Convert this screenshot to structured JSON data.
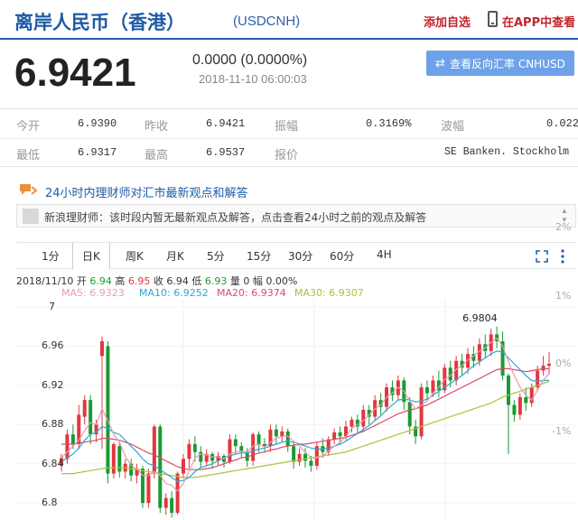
{
  "header": {
    "title": "离岸人民币（香港）",
    "symbol": "(USDCNH)",
    "add_watchlist": "添加自选",
    "app_view": "在APP中查看"
  },
  "quote": {
    "price": "6.9421",
    "change": "0.0000 (0.0000%)",
    "time": "2018-11-10 06:00:03",
    "reverse_button": "查看反向汇率 CNHUSD"
  },
  "stats": {
    "open_label": "今开",
    "open_value": "6.9390",
    "prev_close_label": "昨收",
    "prev_close_value": "6.9421",
    "amplitude_label": "振幅",
    "amplitude_value": "0.3169%",
    "range_label": "波幅",
    "range_value": "0.022",
    "low_label": "最低",
    "low_value": "6.9317",
    "high_label": "最高",
    "high_value": "6.9537",
    "quote_label": "报价",
    "quote_value": "SE Banken. Stockholm"
  },
  "advice": {
    "title": "24小时内理财师对汇市最新观点和解答",
    "message": "新浪理财师：该时段内暂无最新观点及解答，点击查看24小时之前的观点及解答"
  },
  "tabs": [
    "1分",
    "日K",
    "周K",
    "月K",
    "5分",
    "15分",
    "30分",
    "60分",
    "4H"
  ],
  "active_tab": "日K",
  "ohlc": {
    "date": "2018/11/10",
    "open_label": "开",
    "open": "6.94",
    "high_label": "高",
    "high": "6.95",
    "close_label": "收",
    "close": "6.94",
    "low_label": "低",
    "low": "6.93",
    "volume_label": "量",
    "volume": "0",
    "amp_label": "幅",
    "amp": "0.00%"
  },
  "ma": {
    "ma5": "MA5: 6.9323",
    "ma10": "MA10: 6.9252",
    "ma20": "MA20: 6.9374",
    "ma30": "MA30: 6.9307"
  },
  "colors": {
    "up": "#e0383e",
    "down": "#1a9a33",
    "ma5": "#e89bb0",
    "ma10": "#2aa7d6",
    "ma20": "#d94c6a",
    "ma30": "#a6c43a",
    "accent": "#1f5aa6"
  },
  "chart_data": {
    "type": "candlestick",
    "y_ticks_left": [
      "7",
      "6.96",
      "6.92",
      "6.88",
      "6.84",
      "6.8"
    ],
    "y_ticks_right": [
      "2%",
      "1%",
      "0%",
      "-1%"
    ],
    "max_label": "6.9804",
    "ylim": [
      6.79,
      7.0
    ],
    "candles": [
      [
        6.838,
        6.846,
        6.832,
        6.85
      ],
      [
        6.845,
        6.87,
        6.84,
        6.875
      ],
      [
        6.87,
        6.86,
        6.855,
        6.88
      ],
      [
        6.86,
        6.89,
        6.855,
        6.9
      ],
      [
        6.888,
        6.905,
        6.88,
        6.91
      ],
      [
        6.905,
        6.87,
        6.86,
        6.91
      ],
      [
        6.87,
        6.88,
        6.862,
        6.885
      ],
      [
        6.95,
        6.965,
        6.855,
        6.97
      ],
      [
        6.96,
        6.83,
        6.82,
        6.965
      ],
      [
        6.83,
        6.86,
        6.825,
        6.862
      ],
      [
        6.858,
        6.832,
        6.826,
        6.862
      ],
      [
        6.832,
        6.84,
        6.825,
        6.845
      ],
      [
        6.84,
        6.828,
        6.822,
        6.845
      ],
      [
        6.828,
        6.835,
        6.82,
        6.84
      ],
      [
        6.835,
        6.8,
        6.795,
        6.838
      ],
      [
        6.8,
        6.83,
        6.795,
        6.835
      ],
      [
        6.83,
        6.878,
        6.825,
        6.88
      ],
      [
        6.878,
        6.795,
        6.79,
        6.88
      ],
      [
        6.795,
        6.805,
        6.788,
        6.81
      ],
      [
        6.805,
        6.79,
        6.785,
        6.812
      ],
      [
        6.79,
        6.83,
        6.788,
        6.832
      ],
      [
        6.83,
        6.845,
        6.825,
        6.85
      ],
      [
        6.845,
        6.86,
        6.835,
        6.865
      ],
      [
        6.86,
        6.852,
        6.842,
        6.868
      ],
      [
        6.852,
        6.842,
        6.836,
        6.858
      ],
      [
        6.842,
        6.85,
        6.838,
        6.855
      ],
      [
        6.85,
        6.843,
        6.835,
        6.852
      ],
      [
        6.843,
        6.848,
        6.838,
        6.852
      ],
      [
        6.848,
        6.842,
        6.836,
        6.85
      ],
      [
        6.842,
        6.865,
        6.84,
        6.87
      ],
      [
        6.865,
        6.858,
        6.85,
        6.87
      ],
      [
        6.858,
        6.852,
        6.846,
        6.862
      ],
      [
        6.852,
        6.843,
        6.837,
        6.856
      ],
      [
        6.843,
        6.87,
        6.838,
        6.872
      ],
      [
        6.87,
        6.86,
        6.852,
        6.873
      ],
      [
        6.86,
        6.858,
        6.852,
        6.866
      ],
      [
        6.858,
        6.875,
        6.852,
        6.88
      ],
      [
        6.875,
        6.868,
        6.86,
        6.88
      ],
      [
        6.868,
        6.873,
        6.862,
        6.878
      ],
      [
        6.873,
        6.858,
        6.852,
        6.876
      ],
      [
        6.858,
        6.842,
        6.835,
        6.862
      ],
      [
        6.842,
        6.85,
        6.838,
        6.856
      ],
      [
        6.85,
        6.843,
        6.836,
        6.856
      ],
      [
        6.843,
        6.838,
        6.832,
        6.848
      ],
      [
        6.838,
        6.858,
        6.834,
        6.862
      ],
      [
        6.858,
        6.852,
        6.846,
        6.866
      ],
      [
        6.852,
        6.865,
        6.848,
        6.868
      ],
      [
        6.865,
        6.872,
        6.86,
        6.876
      ],
      [
        6.872,
        6.868,
        6.86,
        6.878
      ],
      [
        6.868,
        6.878,
        6.864,
        6.884
      ],
      [
        6.878,
        6.885,
        6.872,
        6.888
      ],
      [
        6.885,
        6.878,
        6.87,
        6.89
      ],
      [
        6.878,
        6.895,
        6.873,
        6.9
      ],
      [
        6.895,
        6.888,
        6.88,
        6.9
      ],
      [
        6.888,
        6.905,
        6.884,
        6.91
      ],
      [
        6.905,
        6.898,
        6.89,
        6.912
      ],
      [
        6.898,
        6.918,
        6.893,
        6.922
      ],
      [
        6.918,
        6.91,
        6.904,
        6.925
      ],
      [
        6.91,
        6.925,
        6.905,
        6.93
      ],
      [
        6.925,
        6.903,
        6.895,
        6.928
      ],
      [
        6.903,
        6.878,
        6.87,
        6.908
      ],
      [
        6.878,
        6.868,
        6.86,
        6.885
      ],
      [
        6.868,
        6.918,
        6.865,
        6.922
      ],
      [
        6.918,
        6.912,
        6.905,
        6.925
      ],
      [
        6.912,
        6.925,
        6.908,
        6.93
      ],
      [
        6.925,
        6.915,
        6.908,
        6.935
      ],
      [
        6.915,
        6.938,
        6.912,
        6.942
      ],
      [
        6.938,
        6.925,
        6.918,
        6.945
      ],
      [
        6.925,
        6.945,
        6.92,
        6.95
      ],
      [
        6.945,
        6.938,
        6.93,
        6.952
      ],
      [
        6.938,
        6.952,
        6.932,
        6.958
      ],
      [
        6.952,
        6.945,
        6.938,
        6.96
      ],
      [
        6.945,
        6.962,
        6.94,
        6.968
      ],
      [
        6.962,
        6.955,
        6.948,
        6.972
      ],
      [
        6.955,
        6.972,
        6.95,
        6.978
      ],
      [
        6.972,
        6.965,
        6.958,
        6.98
      ],
      [
        6.965,
        6.93,
        6.925,
        6.975
      ],
      [
        6.93,
        6.9,
        6.85,
        6.932
      ],
      [
        6.9,
        6.89,
        6.883,
        6.905
      ],
      [
        6.89,
        6.908,
        6.885,
        6.912
      ],
      [
        6.908,
        6.902,
        6.894,
        6.918
      ],
      [
        6.902,
        6.918,
        6.898,
        6.922
      ],
      [
        6.918,
        6.935,
        6.914,
        6.94
      ],
      [
        6.935,
        6.94,
        6.93,
        6.95
      ],
      [
        6.94,
        6.942,
        6.931,
        6.954
      ]
    ],
    "ma5": [
      6.846,
      6.852,
      6.858,
      6.864,
      6.874,
      6.882,
      6.88,
      6.896,
      6.884,
      6.87,
      6.862,
      6.848,
      6.838,
      6.835,
      6.828,
      6.828,
      6.832,
      6.828,
      6.82,
      6.818,
      6.812,
      6.82,
      6.832,
      6.846,
      6.85,
      6.849,
      6.847,
      6.847,
      6.845,
      6.85,
      6.852,
      6.853,
      6.852,
      6.858,
      6.86,
      6.857,
      6.862,
      6.866,
      6.868,
      6.868,
      6.863,
      6.858,
      6.852,
      6.846,
      6.846,
      6.848,
      6.853,
      6.858,
      6.862,
      6.868,
      6.876,
      6.88,
      6.884,
      6.89,
      6.896,
      6.9,
      6.908,
      6.912,
      6.918,
      6.914,
      6.904,
      6.896,
      6.9,
      6.904,
      6.912,
      6.918,
      6.926,
      6.93,
      6.936,
      6.94,
      6.946,
      6.95,
      6.955,
      6.958,
      6.964,
      6.968,
      6.96,
      6.944,
      6.93,
      6.918,
      6.91,
      6.905,
      6.915,
      6.925,
      6.932
    ],
    "ma10": [
      6.842,
      6.846,
      6.85,
      6.856,
      6.864,
      6.87,
      6.872,
      6.878,
      6.876,
      6.872,
      6.87,
      6.864,
      6.858,
      6.852,
      6.845,
      6.84,
      6.838,
      6.834,
      6.83,
      6.826,
      6.822,
      6.823,
      6.826,
      6.832,
      6.836,
      6.838,
      6.84,
      6.843,
      6.846,
      6.848,
      6.85,
      6.851,
      6.851,
      6.853,
      6.855,
      6.856,
      6.858,
      6.86,
      6.862,
      6.863,
      6.862,
      6.86,
      6.858,
      6.856,
      6.855,
      6.855,
      6.856,
      6.858,
      6.86,
      6.863,
      6.867,
      6.871,
      6.875,
      6.879,
      6.884,
      6.889,
      6.895,
      6.9,
      6.905,
      6.906,
      6.905,
      6.903,
      6.904,
      6.906,
      6.91,
      6.914,
      6.918,
      6.922,
      6.926,
      6.93,
      6.935,
      6.94,
      6.944,
      6.948,
      6.952,
      6.955,
      6.954,
      6.948,
      6.942,
      6.936,
      6.93,
      6.925,
      6.924,
      6.925,
      6.925
    ],
    "ma20": [
      6.86,
      6.86,
      6.86,
      6.861,
      6.862,
      6.863,
      6.864,
      6.866,
      6.866,
      6.865,
      6.864,
      6.862,
      6.86,
      6.857,
      6.854,
      6.851,
      6.849,
      6.846,
      6.843,
      6.84,
      6.837,
      6.835,
      6.834,
      6.834,
      6.834,
      6.835,
      6.836,
      6.838,
      6.84,
      6.842,
      6.844,
      6.846,
      6.847,
      6.849,
      6.851,
      6.852,
      6.854,
      6.855,
      6.857,
      6.858,
      6.859,
      6.86,
      6.86,
      6.861,
      6.862,
      6.863,
      6.864,
      6.865,
      6.866,
      6.867,
      6.869,
      6.871,
      6.873,
      6.876,
      6.879,
      6.882,
      6.885,
      6.888,
      6.891,
      6.893,
      6.895,
      6.896,
      6.898,
      6.9,
      6.903,
      6.906,
      6.909,
      6.912,
      6.915,
      6.918,
      6.921,
      6.924,
      6.927,
      6.93,
      6.933,
      6.936,
      6.937,
      6.937,
      6.936,
      6.935,
      6.934,
      6.935,
      6.936,
      6.937,
      6.937
    ],
    "ma30": [
      6.83,
      6.83,
      6.83,
      6.831,
      6.832,
      6.833,
      6.834,
      6.835,
      6.836,
      6.836,
      6.836,
      6.836,
      6.835,
      6.834,
      6.833,
      6.832,
      6.831,
      6.83,
      6.829,
      6.828,
      6.827,
      6.826,
      6.826,
      6.826,
      6.827,
      6.828,
      6.829,
      6.83,
      6.831,
      6.832,
      6.833,
      6.834,
      6.835,
      6.836,
      6.837,
      6.838,
      6.839,
      6.84,
      6.841,
      6.842,
      6.843,
      6.844,
      6.845,
      6.846,
      6.847,
      6.848,
      6.849,
      6.85,
      6.851,
      6.852,
      6.854,
      6.856,
      6.858,
      6.86,
      6.862,
      6.864,
      6.866,
      6.868,
      6.87,
      6.872,
      6.874,
      6.876,
      6.878,
      6.88,
      6.882,
      6.884,
      6.886,
      6.888,
      6.89,
      6.892,
      6.894,
      6.896,
      6.898,
      6.9,
      6.902,
      6.905,
      6.908,
      6.91,
      6.912,
      6.914,
      6.916,
      6.918,
      6.92,
      6.922,
      6.924
    ]
  }
}
